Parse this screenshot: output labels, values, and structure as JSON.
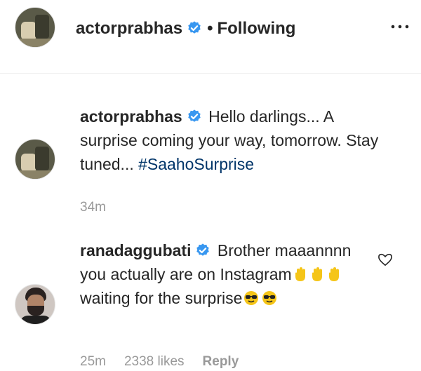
{
  "header": {
    "username": "actorprabhas",
    "separator": "•",
    "follow_status": "Following",
    "more_icon": "more-options-icon"
  },
  "caption": {
    "username": "actorprabhas",
    "text": "Hello darlings... A surprise coming your way, tomorrow. Stay tuned...",
    "hashtag": "#SaahoSurprise",
    "time": "34m"
  },
  "comment": {
    "username": "ranadaggubati",
    "text_1": "Brother maaannnn you actually are on Instagram",
    "text_2": "waiting for the surprise",
    "time": "25m",
    "likes": "2338 likes",
    "reply_label": "Reply",
    "like_icon": "heart-icon"
  },
  "colors": {
    "verified_blue": "#3897f0",
    "hashtag": "#003569",
    "meta_gray": "#999999"
  }
}
